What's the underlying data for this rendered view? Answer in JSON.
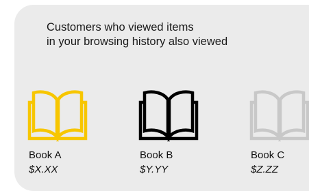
{
  "panel": {
    "heading_line1": "Customers who viewed items",
    "heading_line2": "in your browsing history also viewed"
  },
  "items": [
    {
      "title": "Book A",
      "price": "$X.XX",
      "icon": "open-book-icon",
      "color": "#f7c600"
    },
    {
      "title": "Book B",
      "price": "$Y.YY",
      "icon": "open-book-icon",
      "color": "#000000"
    },
    {
      "title": "Book C",
      "price": "$Z.ZZ",
      "icon": "open-book-icon",
      "color": "#c8c8c8"
    }
  ]
}
